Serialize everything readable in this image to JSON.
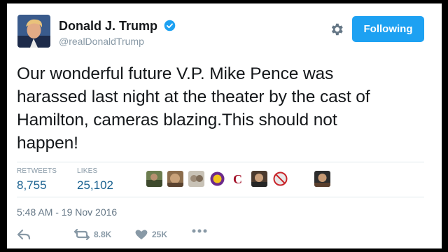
{
  "author": {
    "display_name": "Donald J. Trump",
    "handle": "@realDonaldTrump",
    "verified": true
  },
  "follow_button": {
    "label": "Following",
    "color": "#1da1f2"
  },
  "tweet": {
    "lines": [
      "Our wonderful future V.P. Mike Pence was",
      "harassed last night at the theater by the cast of",
      "Hamilton, cameras blazing.This should not",
      "happen!"
    ]
  },
  "stats": {
    "retweets_label": "RETWEETS",
    "retweets_value": "8,755",
    "likes_label": "LIKES",
    "likes_value": "25,102"
  },
  "timestamp": "5:48 AM - 19 Nov 2016",
  "actions": {
    "reply_icon": "reply-icon",
    "retweet_icon": "retweet-icon",
    "retweet_count": "8.8K",
    "like_icon": "heart-icon",
    "like_count": "25K",
    "more_icon": "more-icon"
  }
}
